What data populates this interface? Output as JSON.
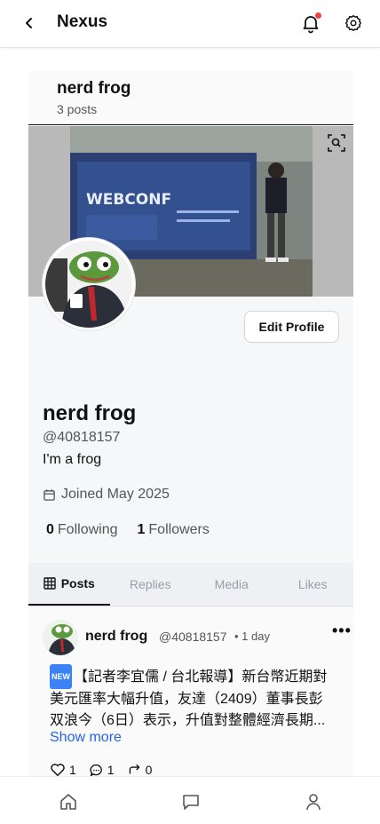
{
  "app": {
    "title": "Nexus"
  },
  "header": {
    "name": "nerd frog",
    "post_count": "3 posts"
  },
  "profile": {
    "display_name": "nerd frog",
    "handle": "@40818157",
    "bio": "I'm a frog",
    "joined": "Joined May 2025",
    "following_count": "0",
    "following_label": "Following",
    "followers_count": "1",
    "followers_label": "Followers",
    "edit_label": "Edit Profile"
  },
  "tabs": [
    {
      "label": "Posts",
      "active": true
    },
    {
      "label": "Replies",
      "active": false
    },
    {
      "label": "Media",
      "active": false
    },
    {
      "label": "Likes",
      "active": false
    }
  ],
  "post": {
    "author": "nerd frog",
    "handle": "@40818157",
    "time": "• 1 day",
    "badge": "NEW",
    "text": "【記者李宜儒 / 台北報導】新台幣近期對美元匯率大幅升值，友達（2409）董事長彭双浪今（6日）表示，升值對整體經濟長期...",
    "show_more": "Show more",
    "likes": "1",
    "comments": "1",
    "reposts": "0"
  },
  "icons": {
    "back": "chevron-left-icon",
    "notifications": "bell-icon",
    "settings": "gear-icon",
    "zoom": "zoom-icon",
    "calendar": "calendar-icon",
    "grid": "grid-icon",
    "more": "more-icon",
    "like": "heart-icon",
    "comment": "comment-icon",
    "repost": "repost-icon",
    "home": "home-icon",
    "messages": "message-icon",
    "profile": "user-icon"
  },
  "colors": {
    "accent_link": "#2563eb",
    "notification_dot": "#ef4444"
  }
}
